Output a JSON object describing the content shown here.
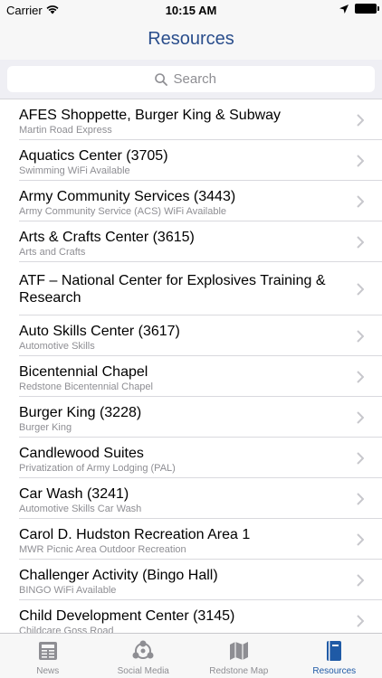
{
  "status_bar": {
    "carrier": "Carrier",
    "time": "10:15 AM"
  },
  "nav": {
    "title": "Resources"
  },
  "search": {
    "placeholder": "Search"
  },
  "list": [
    {
      "title": "AFES Shoppette, Burger King & Subway",
      "subtitle": "Martin Road Express"
    },
    {
      "title": "Aquatics Center (3705)",
      "subtitle": "Swimming WiFi Available"
    },
    {
      "title": "Army Community Services (3443)",
      "subtitle": "Army Community Service (ACS) WiFi Available"
    },
    {
      "title": "Arts & Crafts Center (3615)",
      "subtitle": "Arts and Crafts"
    },
    {
      "title": "ATF – National Center for Explosives Training & Research",
      "subtitle": ""
    },
    {
      "title": "Auto Skills Center (3617)",
      "subtitle": "Automotive Skills"
    },
    {
      "title": "Bicentennial Chapel",
      "subtitle": "Redstone Bicentennial Chapel"
    },
    {
      "title": "Burger King (3228)",
      "subtitle": "Burger King"
    },
    {
      "title": "Candlewood Suites",
      "subtitle": "Privatization of Army Lodging (PAL)"
    },
    {
      "title": "Car Wash (3241)",
      "subtitle": "Automotive Skills Car Wash"
    },
    {
      "title": "Carol D. Hudston Recreation Area 1",
      "subtitle": "MWR Picnic Area Outdoor Recreation"
    },
    {
      "title": "Challenger Activity (Bingo Hall)",
      "subtitle": "BINGO WiFi Available"
    },
    {
      "title": "Child Development Center (3145)",
      "subtitle": "Childcare Goss Road"
    }
  ],
  "tabs": [
    {
      "label": "News",
      "icon": "newspaper-icon",
      "active": false
    },
    {
      "label": "Social Media",
      "icon": "social-network-icon",
      "active": false
    },
    {
      "label": "Redstone Map",
      "icon": "map-icon",
      "active": false
    },
    {
      "label": "Resources",
      "icon": "book-icon",
      "active": true
    }
  ],
  "colors": {
    "accent": "#1f5aa6",
    "title": "#2a4e8c",
    "inactive": "#8e8e93"
  }
}
